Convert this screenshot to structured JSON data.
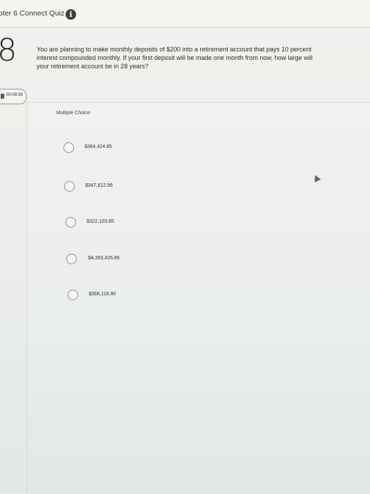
{
  "header": {
    "quiz_title": "pter 6 Connect Quiz",
    "info_icon_glyph": "i"
  },
  "question": {
    "number": "8",
    "text": "You are planning to make monthly deposits of $200 into a retirement account that pays 10 percent interest compounded monthly. If your first deposit will be made one month from now, how large will your retirement account be in 28 years?"
  },
  "timer": {
    "time": "00:09:39"
  },
  "answer_section": {
    "label": "Multiple Choice",
    "options": [
      {
        "label": "$384,424.85"
      },
      {
        "label": "$347,812.96"
      },
      {
        "label": "$322,103.85"
      },
      {
        "label": "$4,393,426.85"
      },
      {
        "label": "$366,118.90"
      }
    ]
  },
  "colors": {
    "radio_border": "#8e8e8e",
    "info_icon_bg": "#3f3f3f"
  }
}
